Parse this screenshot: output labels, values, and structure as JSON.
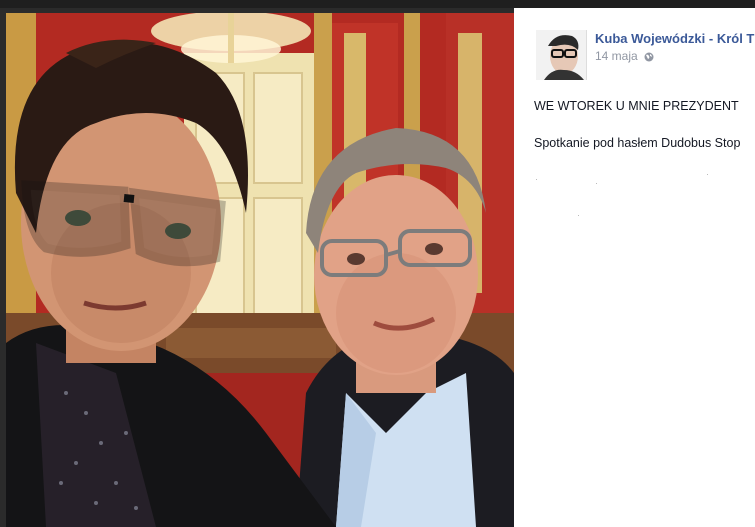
{
  "post": {
    "author": "Kuba Wojewódzki - Król T",
    "date": "14 maja",
    "privacy_icon": "globe-icon",
    "text_line1": "WE WTOREK U MNIE PREZYDENT",
    "text_line2": "Spotkanie pod hasłem Dudobus Stop"
  },
  "colors": {
    "author_link": "#3b5998",
    "meta_text": "#9197a3",
    "body_text": "#141823",
    "wall_red": "#b32a22",
    "door_cream": "#efe2b0"
  }
}
